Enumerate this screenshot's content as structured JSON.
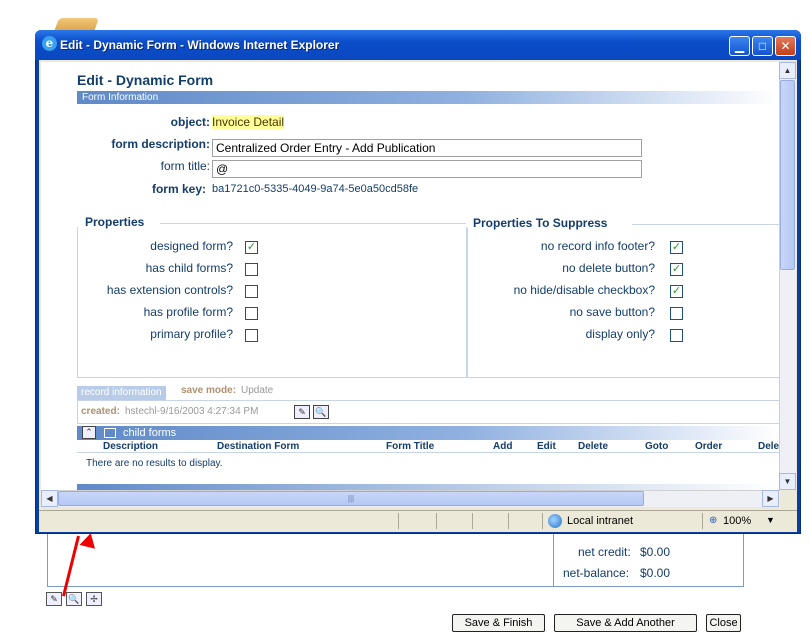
{
  "window": {
    "title": "Edit - Dynamic Form - Windows Internet Explorer",
    "min_glyph": "▁",
    "max_glyph": "□",
    "close_glyph": "✕"
  },
  "page": {
    "heading": "Edit - Dynamic Form",
    "band_form_info": "Form Information",
    "object_label": "object:",
    "object_value": "Invoice Detail",
    "form_description_label": "form description:",
    "form_description_value": "Centralized Order Entry - Add Publication",
    "form_title_label": "form title:",
    "form_title_value": "@",
    "form_key_label": "form key:",
    "form_key_value": "ba1721c0-5335-4049-9a74-5e0a50cd58fe"
  },
  "properties": {
    "title": "Properties",
    "items": [
      {
        "label": "designed form?",
        "checked": true
      },
      {
        "label": "has child forms?",
        "checked": false
      },
      {
        "label": "has extension controls?",
        "checked": false
      },
      {
        "label": "has profile form?",
        "checked": false
      },
      {
        "label": "primary profile?",
        "checked": false
      }
    ]
  },
  "suppress": {
    "title": "Properties To Suppress",
    "items": [
      {
        "label": "no record info footer?",
        "checked": true
      },
      {
        "label": "no delete button?",
        "checked": true
      },
      {
        "label": "no hide/disable checkbox?",
        "checked": true
      },
      {
        "label": "no save button?",
        "checked": false
      },
      {
        "label": "display only?",
        "checked": false
      }
    ]
  },
  "record": {
    "tag": "record information",
    "save_mode_label": "save mode:",
    "save_mode_value": "Update",
    "created_label": "created:",
    "created_value": "hstechl-9/16/2003 4:27:34 PM"
  },
  "child_forms": {
    "band": "child forms",
    "columns": [
      "Description",
      "Destination Form",
      "Form Title",
      "Add",
      "Edit",
      "Delete",
      "Goto",
      "Order",
      "Dele"
    ],
    "empty_text": "There are no results to display."
  },
  "status": {
    "zone": "Local intranet",
    "zoom": "100%"
  },
  "background": {
    "net_credit_label": "net credit:",
    "net_credit_value": "$0.00",
    "net_balance_label": "net-balance:",
    "net_balance_value": "$0.00",
    "buttons": [
      "Save & Finish",
      "Save & Add Another",
      "Close"
    ]
  },
  "colors": {
    "title_bar": "#0b4cc8",
    "heading": "#133d6b",
    "highlight": "#ffff99",
    "arrow": "#e00000"
  },
  "icons": {
    "edit": "✎",
    "search": "🔍",
    "check": "✓",
    "up_chevron": "⌃",
    "arrow_left": "◀",
    "arrow_right": "▶",
    "arrow_up": "▲",
    "arrow_down": "▼"
  }
}
